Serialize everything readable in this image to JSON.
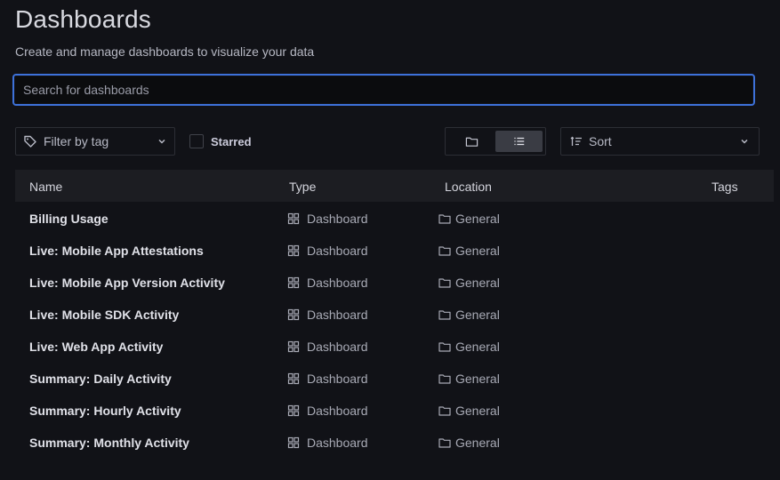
{
  "page": {
    "title": "Dashboards",
    "subtitle": "Create and manage dashboards to visualize your data"
  },
  "search": {
    "placeholder": "Search for dashboards",
    "value": ""
  },
  "filters": {
    "tag_filter_label": "Filter by tag",
    "starred_label": "Starred",
    "starred_checked": false,
    "view_mode": "list",
    "sort_label": "Sort"
  },
  "icons": {
    "tag": "tag-icon",
    "chevron": "chevron-down-icon",
    "folder_view": "folder-view-icon",
    "list_view": "list-view-icon",
    "sort": "sort-icon",
    "dashboard": "dashboard-grid-icon",
    "folder": "folder-icon"
  },
  "colors": {
    "background": "#111217",
    "accent_focus": "#3d71d9",
    "header_bg": "#1c1d22"
  },
  "table": {
    "columns": {
      "name": "Name",
      "type": "Type",
      "location": "Location",
      "tags": "Tags"
    },
    "rows": [
      {
        "name": "Billing Usage",
        "type": "Dashboard",
        "location": "General"
      },
      {
        "name": "Live: Mobile App Attestations",
        "type": "Dashboard",
        "location": "General"
      },
      {
        "name": "Live: Mobile App Version Activity",
        "type": "Dashboard",
        "location": "General"
      },
      {
        "name": "Live: Mobile SDK Activity",
        "type": "Dashboard",
        "location": "General"
      },
      {
        "name": "Live: Web App Activity",
        "type": "Dashboard",
        "location": "General"
      },
      {
        "name": "Summary: Daily Activity",
        "type": "Dashboard",
        "location": "General"
      },
      {
        "name": "Summary: Hourly Activity",
        "type": "Dashboard",
        "location": "General"
      },
      {
        "name": "Summary: Monthly Activity",
        "type": "Dashboard",
        "location": "General"
      }
    ]
  }
}
